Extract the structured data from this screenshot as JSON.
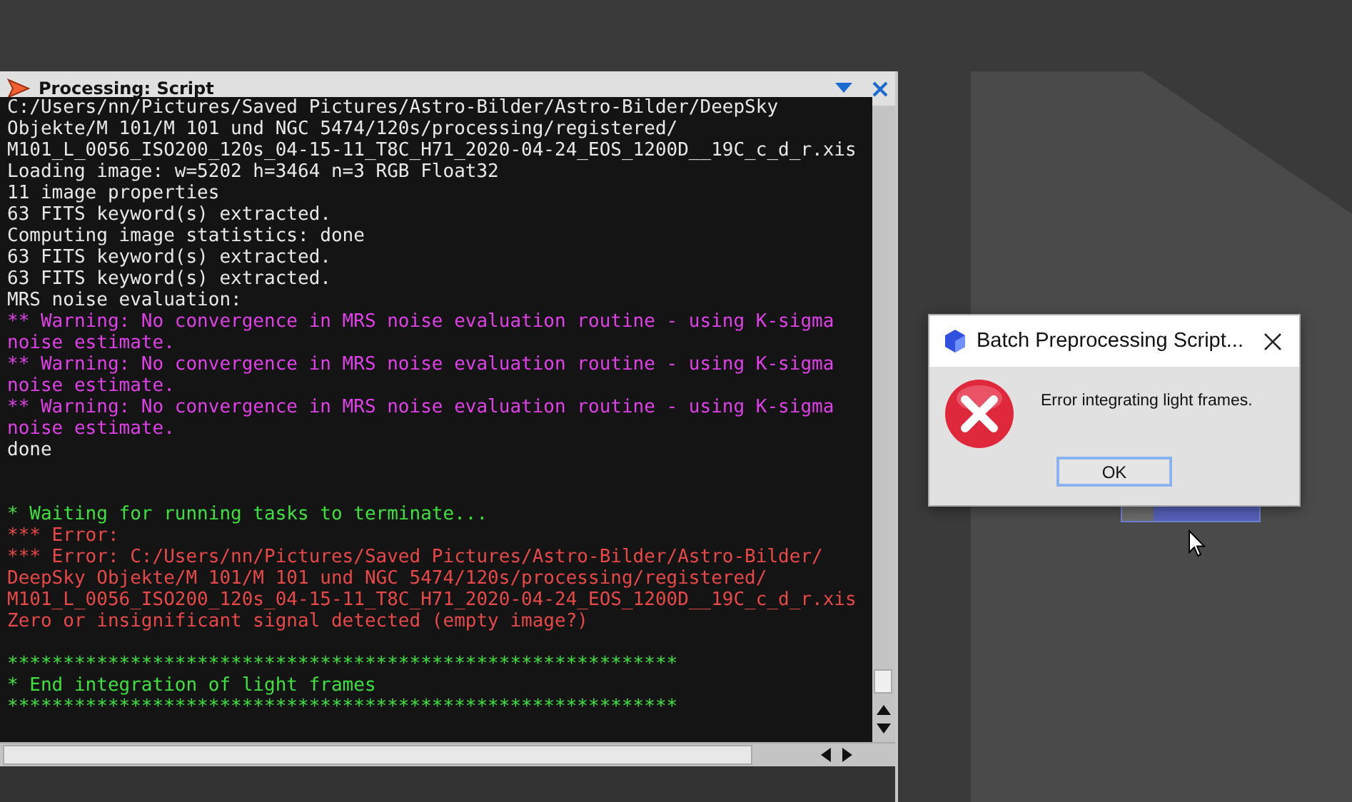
{
  "window": {
    "title": "Processing: Script"
  },
  "console": {
    "lines": [
      {
        "kind": "normal",
        "text": "C:/Users/nn/Pictures/Saved Pictures/Astro-Bilder/Astro-Bilder/DeepSky"
      },
      {
        "kind": "normal",
        "text": "Objekte/M 101/M 101 und NGC 5474/120s/processing/registered/"
      },
      {
        "kind": "normal",
        "text": "M101_L_0056_ISO200_120s_04-15-11_T8C_H71_2020-04-24_EOS_1200D__19C_c_d_r.xis"
      },
      {
        "kind": "normal",
        "text": "Loading image: w=5202 h=3464 n=3 RGB Float32"
      },
      {
        "kind": "normal",
        "text": "11 image properties"
      },
      {
        "kind": "normal",
        "text": "63 FITS keyword(s) extracted."
      },
      {
        "kind": "normal",
        "text": "Computing image statistics: done"
      },
      {
        "kind": "normal",
        "text": "63 FITS keyword(s) extracted."
      },
      {
        "kind": "normal",
        "text": "63 FITS keyword(s) extracted."
      },
      {
        "kind": "normal",
        "text": "MRS noise evaluation:"
      },
      {
        "kind": "warning",
        "text": "** Warning: No convergence in MRS noise evaluation routine - using K-sigma"
      },
      {
        "kind": "warning",
        "text": "noise estimate."
      },
      {
        "kind": "warning",
        "text": "** Warning: No convergence in MRS noise evaluation routine - using K-sigma"
      },
      {
        "kind": "warning",
        "text": "noise estimate."
      },
      {
        "kind": "warning",
        "text": "** Warning: No convergence in MRS noise evaluation routine - using K-sigma"
      },
      {
        "kind": "warning",
        "text": "noise estimate."
      },
      {
        "kind": "normal",
        "text": "done"
      },
      {
        "kind": "blank"
      },
      {
        "kind": "blank"
      },
      {
        "kind": "info",
        "text": "* Waiting for running tasks to terminate..."
      },
      {
        "kind": "error",
        "text": "*** Error:"
      },
      {
        "kind": "error",
        "text": "*** Error: C:/Users/nn/Pictures/Saved Pictures/Astro-Bilder/Astro-Bilder/"
      },
      {
        "kind": "error",
        "text": "DeepSky Objekte/M 101/M 101 und NGC 5474/120s/processing/registered/"
      },
      {
        "kind": "error",
        "text": "M101_L_0056_ISO200_120s_04-15-11_T8C_H71_2020-04-24_EOS_1200D__19C_c_d_r.xis"
      },
      {
        "kind": "error",
        "text": "Zero or insignificant signal detected (empty image?)"
      },
      {
        "kind": "blank"
      },
      {
        "kind": "info",
        "text": "************************************************************"
      },
      {
        "kind": "info",
        "text": "* End integration of light frames"
      },
      {
        "kind": "info",
        "text": "************************************************************"
      }
    ]
  },
  "dialog": {
    "title": "Batch Preprocessing Script...",
    "message": "Error integrating light frames.",
    "button": "OK"
  }
}
